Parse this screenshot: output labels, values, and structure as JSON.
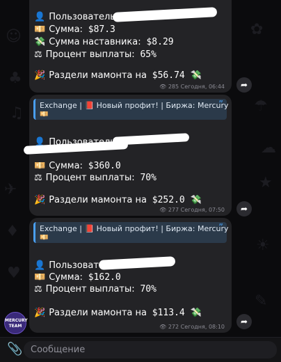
{
  "messages": [
    {
      "user_label": "Пользователь:",
      "amount_label": "Сумма:",
      "amount_value": "$87.3",
      "mentor_label": "Сумма наставника:",
      "mentor_value": "$8.29",
      "percent_label": "Процент выплаты:",
      "percent_value": "65%",
      "split_label": "Раздели мамонта на",
      "split_value": "$56.74",
      "views": "285",
      "time": "Сегодня, 06:44"
    },
    {
      "quote": "Exchange | 📕 Новый профит! | Биржа: Mercury",
      "user_label": "Пользователь:",
      "amount_label": "Сумма:",
      "amount_value": "$360.0",
      "percent_label": "Процент выплаты:",
      "percent_value": "70%",
      "split_label": "Раздели мамонта на",
      "split_value": "$252.0",
      "views": "277",
      "time": "Сегодня, 07:50"
    },
    {
      "quote": "Exchange | 📕 Новый профит! | Биржа: Mercury",
      "user_label": "Пользовате",
      "amount_label": "Сумма:",
      "amount_value": "$162.0",
      "percent_label": "Процент выплаты:",
      "percent_value": "70%",
      "split_label": "Раздели мамонта на",
      "split_value": "$113.4",
      "views": "272",
      "time": "Сегодня, 08:10"
    }
  ],
  "avatar_text": "MERCURY TEAM",
  "composer": {
    "placeholder": "Сообщение"
  },
  "icons": {
    "user": "bust-icon",
    "money": "banknote-icon",
    "wings": "money-wings-icon",
    "scales": "scales-icon",
    "party": "party-popper-icon",
    "share": "share-arrow-icon",
    "eye": "eye-icon",
    "attach": "paperclip-icon"
  },
  "colors": {
    "bubble": "#232326",
    "quote_bar": "#4a9ff0",
    "background": "#0b0b0d"
  }
}
